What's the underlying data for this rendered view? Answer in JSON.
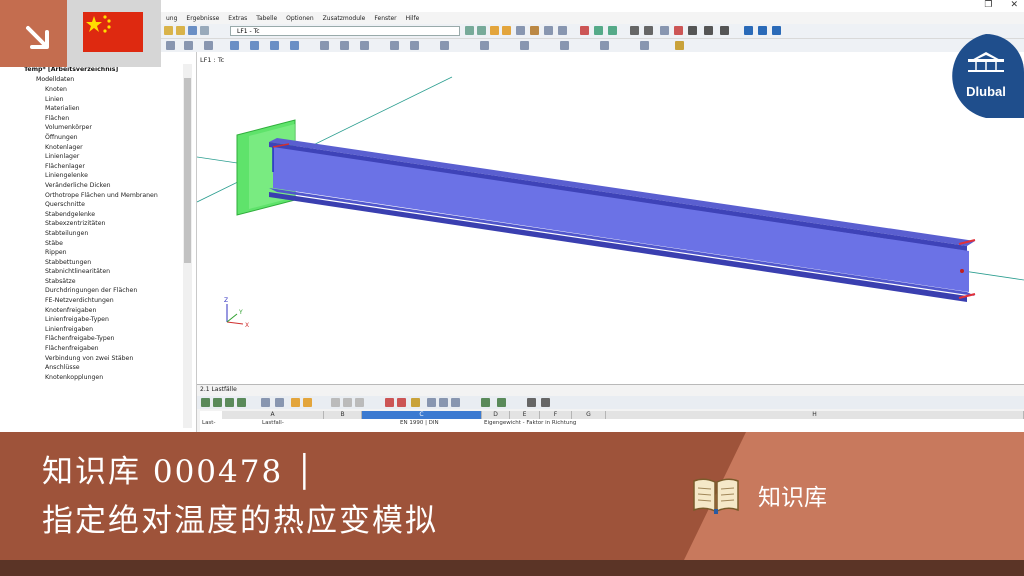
{
  "window": {
    "restore_glyph": "❐",
    "close_glyph": "✕"
  },
  "menu": {
    "items": [
      "ung",
      "Ergebnisse",
      "Extras",
      "Tabelle",
      "Optionen",
      "Zusatzmodule",
      "Fenster",
      "Hilfe"
    ]
  },
  "toolbar": {
    "loadcase_combo": "LF1 - Tc"
  },
  "navigator": {
    "root": "Temp* [Arbeitsverzeichnis]",
    "model_data": "Modelldaten",
    "items": [
      "Knoten",
      "Linien",
      "Materialien",
      "Flächen",
      "Volumenkörper",
      "Öffnungen",
      "Knotenlager",
      "Linienlager",
      "Flächenlager",
      "Liniengelenke",
      "Veränderliche Dicken",
      "Orthotrope Flächen und Membranen",
      "Querschnitte",
      "Stabendgelenke",
      "Stabexzentrizitäten",
      "Stabteilungen",
      "Stäbe",
      "Rippen",
      "Stabbettungen",
      "Stabnichtlinearitäten",
      "Stabsätze",
      "Durchdringungen der Flächen",
      "FE-Netzverdichtungen",
      "Knotenfreigaben",
      "Linienfreigabe-Typen",
      "Linienfreigaben",
      "Flächenfreigabe-Typen",
      "Flächenfreigaben",
      "Verbindung von zwei Stäben",
      "Anschlüsse",
      "Knotenkopplungen"
    ]
  },
  "viewport": {
    "label": "LF1 : Tc",
    "axes": {
      "x": "X",
      "y": "Y",
      "z": "Z"
    }
  },
  "table": {
    "title": "2.1 Lastfälle",
    "columns": [
      "A",
      "B",
      "C",
      "D",
      "E",
      "F",
      "G",
      "H"
    ],
    "row_header": "Last-",
    "sub_a": "Lastfall-",
    "sub_c": "EN 1990 | DIN",
    "sub_d": "Eigengewicht - Faktor in Richtung"
  },
  "banner": {
    "line1": "知识库  000478 │",
    "line2": "指定绝对温度的热应变模拟",
    "right_label": "知识库",
    "book_icon": "open-book-icon"
  },
  "logo": {
    "text": "Dlubal"
  },
  "colors": {
    "banner": "#9e533a",
    "banner_light": "#c8795d",
    "beam": "#4a55d9",
    "support": "#44dd55",
    "flag_red": "#de2910",
    "flag_yellow": "#ffde00",
    "logo_blue": "#1f4e8c"
  }
}
